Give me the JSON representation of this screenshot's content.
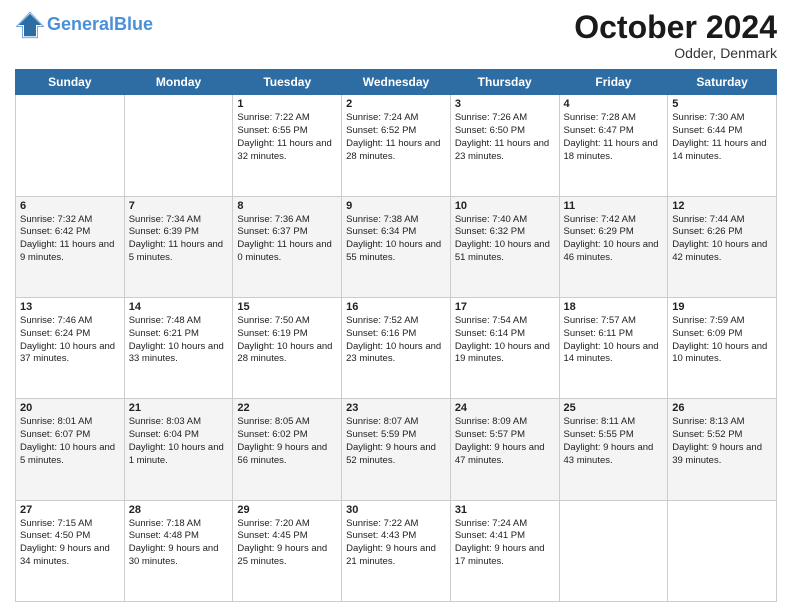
{
  "header": {
    "logo_line1": "General",
    "logo_line2": "Blue",
    "month": "October 2024",
    "location": "Odder, Denmark"
  },
  "weekdays": [
    "Sunday",
    "Monday",
    "Tuesday",
    "Wednesday",
    "Thursday",
    "Friday",
    "Saturday"
  ],
  "weeks": [
    [
      {
        "day": "",
        "sunrise": "",
        "sunset": "",
        "daylight": ""
      },
      {
        "day": "",
        "sunrise": "",
        "sunset": "",
        "daylight": ""
      },
      {
        "day": "1",
        "sunrise": "Sunrise: 7:22 AM",
        "sunset": "Sunset: 6:55 PM",
        "daylight": "Daylight: 11 hours and 32 minutes."
      },
      {
        "day": "2",
        "sunrise": "Sunrise: 7:24 AM",
        "sunset": "Sunset: 6:52 PM",
        "daylight": "Daylight: 11 hours and 28 minutes."
      },
      {
        "day": "3",
        "sunrise": "Sunrise: 7:26 AM",
        "sunset": "Sunset: 6:50 PM",
        "daylight": "Daylight: 11 hours and 23 minutes."
      },
      {
        "day": "4",
        "sunrise": "Sunrise: 7:28 AM",
        "sunset": "Sunset: 6:47 PM",
        "daylight": "Daylight: 11 hours and 18 minutes."
      },
      {
        "day": "5",
        "sunrise": "Sunrise: 7:30 AM",
        "sunset": "Sunset: 6:44 PM",
        "daylight": "Daylight: 11 hours and 14 minutes."
      }
    ],
    [
      {
        "day": "6",
        "sunrise": "Sunrise: 7:32 AM",
        "sunset": "Sunset: 6:42 PM",
        "daylight": "Daylight: 11 hours and 9 minutes."
      },
      {
        "day": "7",
        "sunrise": "Sunrise: 7:34 AM",
        "sunset": "Sunset: 6:39 PM",
        "daylight": "Daylight: 11 hours and 5 minutes."
      },
      {
        "day": "8",
        "sunrise": "Sunrise: 7:36 AM",
        "sunset": "Sunset: 6:37 PM",
        "daylight": "Daylight: 11 hours and 0 minutes."
      },
      {
        "day": "9",
        "sunrise": "Sunrise: 7:38 AM",
        "sunset": "Sunset: 6:34 PM",
        "daylight": "Daylight: 10 hours and 55 minutes."
      },
      {
        "day": "10",
        "sunrise": "Sunrise: 7:40 AM",
        "sunset": "Sunset: 6:32 PM",
        "daylight": "Daylight: 10 hours and 51 minutes."
      },
      {
        "day": "11",
        "sunrise": "Sunrise: 7:42 AM",
        "sunset": "Sunset: 6:29 PM",
        "daylight": "Daylight: 10 hours and 46 minutes."
      },
      {
        "day": "12",
        "sunrise": "Sunrise: 7:44 AM",
        "sunset": "Sunset: 6:26 PM",
        "daylight": "Daylight: 10 hours and 42 minutes."
      }
    ],
    [
      {
        "day": "13",
        "sunrise": "Sunrise: 7:46 AM",
        "sunset": "Sunset: 6:24 PM",
        "daylight": "Daylight: 10 hours and 37 minutes."
      },
      {
        "day": "14",
        "sunrise": "Sunrise: 7:48 AM",
        "sunset": "Sunset: 6:21 PM",
        "daylight": "Daylight: 10 hours and 33 minutes."
      },
      {
        "day": "15",
        "sunrise": "Sunrise: 7:50 AM",
        "sunset": "Sunset: 6:19 PM",
        "daylight": "Daylight: 10 hours and 28 minutes."
      },
      {
        "day": "16",
        "sunrise": "Sunrise: 7:52 AM",
        "sunset": "Sunset: 6:16 PM",
        "daylight": "Daylight: 10 hours and 23 minutes."
      },
      {
        "day": "17",
        "sunrise": "Sunrise: 7:54 AM",
        "sunset": "Sunset: 6:14 PM",
        "daylight": "Daylight: 10 hours and 19 minutes."
      },
      {
        "day": "18",
        "sunrise": "Sunrise: 7:57 AM",
        "sunset": "Sunset: 6:11 PM",
        "daylight": "Daylight: 10 hours and 14 minutes."
      },
      {
        "day": "19",
        "sunrise": "Sunrise: 7:59 AM",
        "sunset": "Sunset: 6:09 PM",
        "daylight": "Daylight: 10 hours and 10 minutes."
      }
    ],
    [
      {
        "day": "20",
        "sunrise": "Sunrise: 8:01 AM",
        "sunset": "Sunset: 6:07 PM",
        "daylight": "Daylight: 10 hours and 5 minutes."
      },
      {
        "day": "21",
        "sunrise": "Sunrise: 8:03 AM",
        "sunset": "Sunset: 6:04 PM",
        "daylight": "Daylight: 10 hours and 1 minute."
      },
      {
        "day": "22",
        "sunrise": "Sunrise: 8:05 AM",
        "sunset": "Sunset: 6:02 PM",
        "daylight": "Daylight: 9 hours and 56 minutes."
      },
      {
        "day": "23",
        "sunrise": "Sunrise: 8:07 AM",
        "sunset": "Sunset: 5:59 PM",
        "daylight": "Daylight: 9 hours and 52 minutes."
      },
      {
        "day": "24",
        "sunrise": "Sunrise: 8:09 AM",
        "sunset": "Sunset: 5:57 PM",
        "daylight": "Daylight: 9 hours and 47 minutes."
      },
      {
        "day": "25",
        "sunrise": "Sunrise: 8:11 AM",
        "sunset": "Sunset: 5:55 PM",
        "daylight": "Daylight: 9 hours and 43 minutes."
      },
      {
        "day": "26",
        "sunrise": "Sunrise: 8:13 AM",
        "sunset": "Sunset: 5:52 PM",
        "daylight": "Daylight: 9 hours and 39 minutes."
      }
    ],
    [
      {
        "day": "27",
        "sunrise": "Sunrise: 7:15 AM",
        "sunset": "Sunset: 4:50 PM",
        "daylight": "Daylight: 9 hours and 34 minutes."
      },
      {
        "day": "28",
        "sunrise": "Sunrise: 7:18 AM",
        "sunset": "Sunset: 4:48 PM",
        "daylight": "Daylight: 9 hours and 30 minutes."
      },
      {
        "day": "29",
        "sunrise": "Sunrise: 7:20 AM",
        "sunset": "Sunset: 4:45 PM",
        "daylight": "Daylight: 9 hours and 25 minutes."
      },
      {
        "day": "30",
        "sunrise": "Sunrise: 7:22 AM",
        "sunset": "Sunset: 4:43 PM",
        "daylight": "Daylight: 9 hours and 21 minutes."
      },
      {
        "day": "31",
        "sunrise": "Sunrise: 7:24 AM",
        "sunset": "Sunset: 4:41 PM",
        "daylight": "Daylight: 9 hours and 17 minutes."
      },
      {
        "day": "",
        "sunrise": "",
        "sunset": "",
        "daylight": ""
      },
      {
        "day": "",
        "sunrise": "",
        "sunset": "",
        "daylight": ""
      }
    ]
  ]
}
